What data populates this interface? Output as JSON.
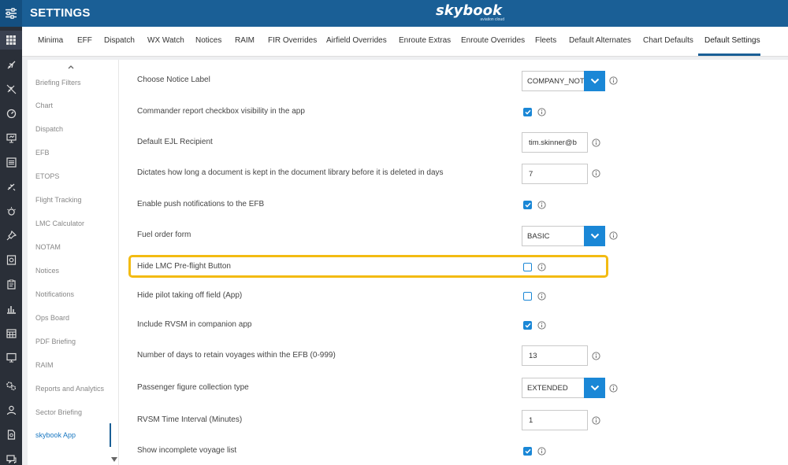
{
  "header": {
    "title": "SETTINGS",
    "brand": "skybook",
    "brand_tagline": "aviation cloud"
  },
  "rail_icons": [
    "grid-icon",
    "plane-icon",
    "plane-slash-icon",
    "gauge-icon",
    "presentation-icon",
    "list-icon",
    "plane-small-icon",
    "weather-icon",
    "pin-icon",
    "book-icon",
    "clipboard-icon",
    "bar-chart-icon",
    "calendar-icon",
    "monitor-icon",
    "gears-icon",
    "user-icon",
    "document-icon",
    "chat-icon"
  ],
  "tabs": [
    {
      "label": "Minima"
    },
    {
      "label": "EFF"
    },
    {
      "label": "Dispatch"
    },
    {
      "label": "WX Watch"
    },
    {
      "label": "Notices"
    },
    {
      "label": "RAIM"
    },
    {
      "label": "FIR Overrides"
    },
    {
      "label": "Airfield Overrides"
    },
    {
      "label": "Enroute Extras"
    },
    {
      "label": "Enroute Overrides"
    },
    {
      "label": "Fleets"
    },
    {
      "label": "Default Alternates"
    },
    {
      "label": "Chart Defaults"
    },
    {
      "label": "Default Settings",
      "active": true
    }
  ],
  "categories": [
    {
      "label": "Briefing Filters"
    },
    {
      "label": "Chart"
    },
    {
      "label": "Dispatch"
    },
    {
      "label": "EFB"
    },
    {
      "label": "ETOPS"
    },
    {
      "label": "Flight Tracking"
    },
    {
      "label": "LMC Calculator"
    },
    {
      "label": "NOTAM"
    },
    {
      "label": "Notices"
    },
    {
      "label": "Notifications"
    },
    {
      "label": "Ops Board"
    },
    {
      "label": "PDF Briefing"
    },
    {
      "label": "RAIM"
    },
    {
      "label": "Reports and Analytics"
    },
    {
      "label": "Sector Briefing"
    },
    {
      "label": "skybook App",
      "active": true
    }
  ],
  "settings": [
    {
      "label": "Choose Notice Label",
      "control": "select",
      "value": "COMPANY_NOTICE"
    },
    {
      "label": "Commander report checkbox visibility in the app",
      "control": "checkbox",
      "checked": true
    },
    {
      "label": "Default EJL Recipient",
      "control": "input",
      "value": "tim.skinner@b"
    },
    {
      "label": "Dictates how long a document is kept in the document library before it is deleted in days",
      "control": "input",
      "value": "7"
    },
    {
      "label": "Enable push notifications to the EFB",
      "control": "checkbox",
      "checked": true
    },
    {
      "label": "Fuel order form",
      "control": "select",
      "value": "BASIC"
    },
    {
      "label": "Hide LMC Pre-flight Button",
      "control": "checkbox",
      "checked": false,
      "highlighted": true
    },
    {
      "label": "Hide pilot taking off field (App)",
      "control": "checkbox",
      "checked": false
    },
    {
      "label": "Include RVSM in companion app",
      "control": "checkbox",
      "checked": true
    },
    {
      "label": "Number of days to retain voyages within the EFB (0-999)",
      "control": "input",
      "value": "13"
    },
    {
      "label": "Passenger figure collection type",
      "control": "select",
      "value": "EXTENDED"
    },
    {
      "label": "RVSM Time Interval (Minutes)",
      "control": "input",
      "value": "1"
    },
    {
      "label": "Show incomplete voyage list",
      "control": "checkbox",
      "checked": true
    }
  ],
  "colors": {
    "header": "#1a5f96",
    "rail": "#2a2f38",
    "accent": "#1a87d6",
    "highlight": "#f3bb12"
  }
}
